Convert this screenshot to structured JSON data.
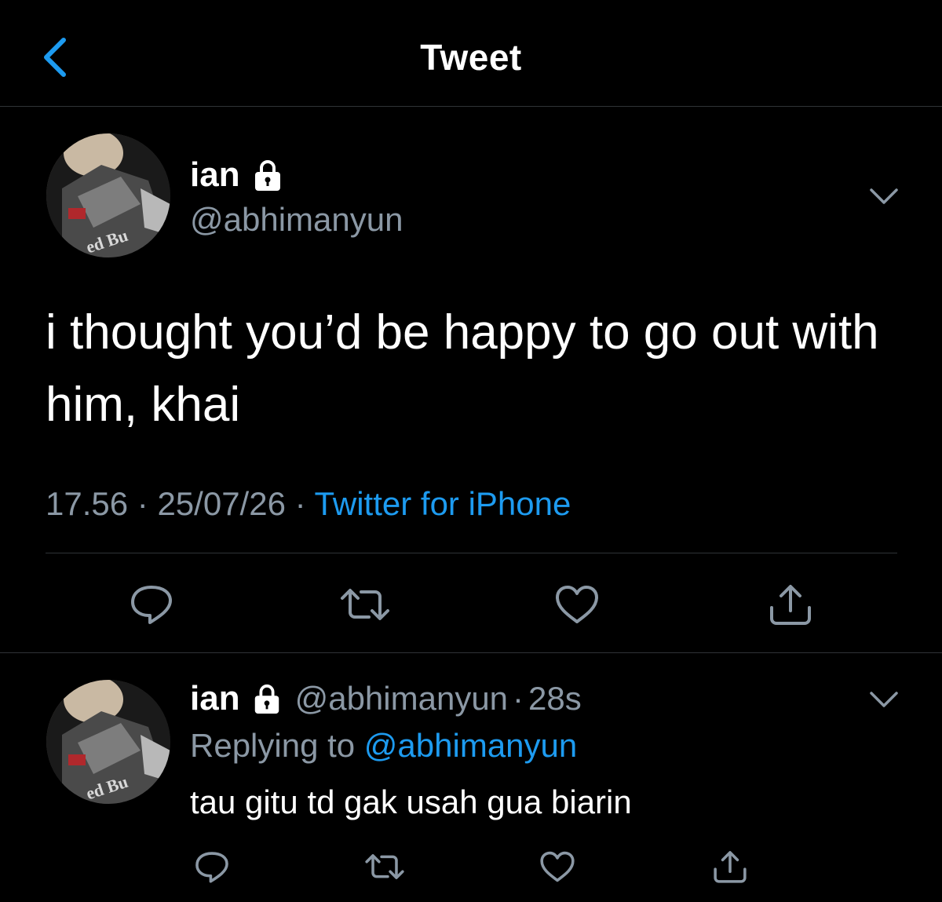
{
  "header": {
    "title": "Tweet",
    "back_icon": "chevron-left-icon",
    "accent_color": "#1d9bf0"
  },
  "tweet": {
    "name": "ian",
    "locked_icon": "lock-icon",
    "handle": "@abhimanyun",
    "text": "i thought you’d be happy to go out with him, khai",
    "time": "17.56",
    "date": "25/07/26",
    "separator": "·",
    "source": "Twitter for iPhone",
    "actions": [
      "reply-icon",
      "retweet-icon",
      "like-icon",
      "share-icon"
    ]
  },
  "reply": {
    "name": "ian",
    "handle": "@abhimanyun",
    "separator": "·",
    "time": "28s",
    "replying_prefix": "Replying to",
    "replying_to": "@abhimanyun",
    "text": "tau gitu td gak usah gua biarin",
    "actions": [
      "reply-icon",
      "retweet-icon",
      "like-icon",
      "share-icon"
    ]
  },
  "colors": {
    "background": "#000000",
    "text_primary": "#ffffff",
    "text_secondary": "#8b98a5",
    "link": "#1d9bf0",
    "divider": "#2f3336"
  }
}
